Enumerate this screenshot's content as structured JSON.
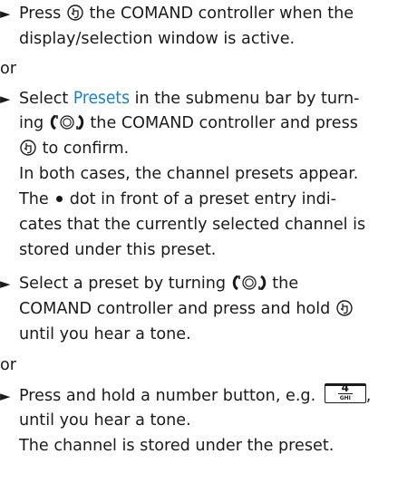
{
  "steps": {
    "step1": {
      "bullet": "►",
      "l1a": "Press",
      "l1b": "the COMAND controller when the",
      "l2": "display/selection window is active."
    },
    "or1": "or",
    "step2": {
      "bullet": "►",
      "l1a": "Select",
      "keyword": "Presets",
      "l1b": "in the submenu bar by turn-",
      "l2a": "ing",
      "l2b": "the COMAND controller and press",
      "l3": "to confirm.",
      "l4": "In both cases, the channel presets appear.",
      "l5a": "The",
      "l5b": "dot in front of a preset entry indi-",
      "l6": "cates that the currently selected channel is",
      "l7": "stored under this preset."
    },
    "step3": {
      "bullet": "►",
      "l1a": "Select a preset by turning",
      "l1b": "the",
      "l2": "COMAND controller and press and hold",
      "l3": "until you hear a tone."
    },
    "or2": "or",
    "step4": {
      "bullet": "►",
      "l1": "Press and hold a number button, e.g.",
      "comma": ",",
      "button_number": "4",
      "button_letters": "GHI",
      "l2": "until you hear a tone.",
      "l3": "The channel is stored under the preset."
    }
  },
  "icons": [
    "press-controller-icon",
    "turn-controller-icon",
    "dot-icon",
    "number-button-4-icon"
  ],
  "colors": {
    "text": "#1a1a1a",
    "keyword": "#1f7fc0",
    "background": "#ffffff"
  }
}
